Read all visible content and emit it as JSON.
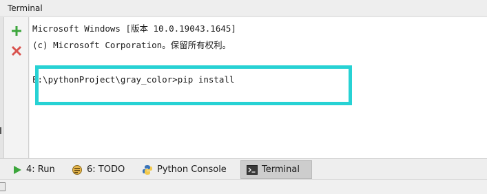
{
  "window": {
    "title": "Terminal"
  },
  "toolbar": {
    "new_session_icon": "plus-icon",
    "close_session_icon": "close-x-icon",
    "colors": {
      "plus": "#3ca63c",
      "close": "#d9534f"
    }
  },
  "terminal": {
    "lines": [
      "Microsoft Windows [版本 10.0.19043.1645]",
      "(c) Microsoft Corporation。保留所有权利。",
      "",
      "E:\\pythonProject\\gray_color>pip install"
    ],
    "highlight_color": "#27d2d4"
  },
  "tabs": [
    {
      "label": "4: Run",
      "icon": "run-play-icon"
    },
    {
      "label": "6: TODO",
      "icon": "todo-icon"
    },
    {
      "label": "Python Console",
      "icon": "python-icon"
    },
    {
      "label": "Terminal",
      "icon": "terminal-icon",
      "active": true
    }
  ]
}
